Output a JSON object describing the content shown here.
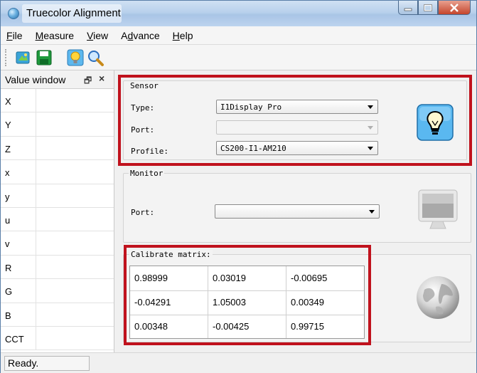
{
  "window": {
    "title": "Truecolor Alignment"
  },
  "menu": {
    "items": [
      {
        "label": "File",
        "mnemonic": "F",
        "rest": "ile"
      },
      {
        "label": "Measure",
        "mnemonic": "M",
        "rest": "easure"
      },
      {
        "label": "View",
        "mnemonic": "V",
        "rest": "iew"
      },
      {
        "label": "Advance",
        "pre": "A",
        "mnemonic": "d",
        "rest": "vance"
      },
      {
        "label": "Help",
        "mnemonic": "H",
        "rest": "elp"
      }
    ]
  },
  "toolbar": {
    "icons": [
      "connect-icon",
      "save-icon",
      "bulb-icon",
      "search-icon"
    ]
  },
  "value_window": {
    "title": "Value window",
    "float_glyph": "🗗",
    "close_glyph": "×",
    "rows": [
      {
        "label": "X",
        "value": ""
      },
      {
        "label": "Y",
        "value": ""
      },
      {
        "label": "Z",
        "value": ""
      },
      {
        "label": "x",
        "value": ""
      },
      {
        "label": "y",
        "value": ""
      },
      {
        "label": "u",
        "value": ""
      },
      {
        "label": "v",
        "value": ""
      },
      {
        "label": "R",
        "value": ""
      },
      {
        "label": "G",
        "value": ""
      },
      {
        "label": "B",
        "value": ""
      },
      {
        "label": "CCT",
        "value": ""
      }
    ]
  },
  "sensor": {
    "title": "Sensor",
    "type_label": "Type:",
    "type_value": "I1Display Pro",
    "port_label": "Port:",
    "port_value": "",
    "profile_label": "Profile:",
    "profile_value": "CS200-I1-AM210"
  },
  "monitor": {
    "title": "Monitor",
    "port_label": "Port:",
    "port_value": ""
  },
  "calibrate": {
    "title": "Calibrate matrix:",
    "matrix": [
      [
        "0.98999",
        "0.03019",
        "-0.00695"
      ],
      [
        "-0.04291",
        "1.05003",
        "0.00349"
      ],
      [
        "0.00348",
        "-0.00425",
        "0.99715"
      ]
    ]
  },
  "status": {
    "text": "Ready."
  },
  "colors": {
    "highlight": "#c0121d",
    "title_bar": "#b9d1ec"
  }
}
